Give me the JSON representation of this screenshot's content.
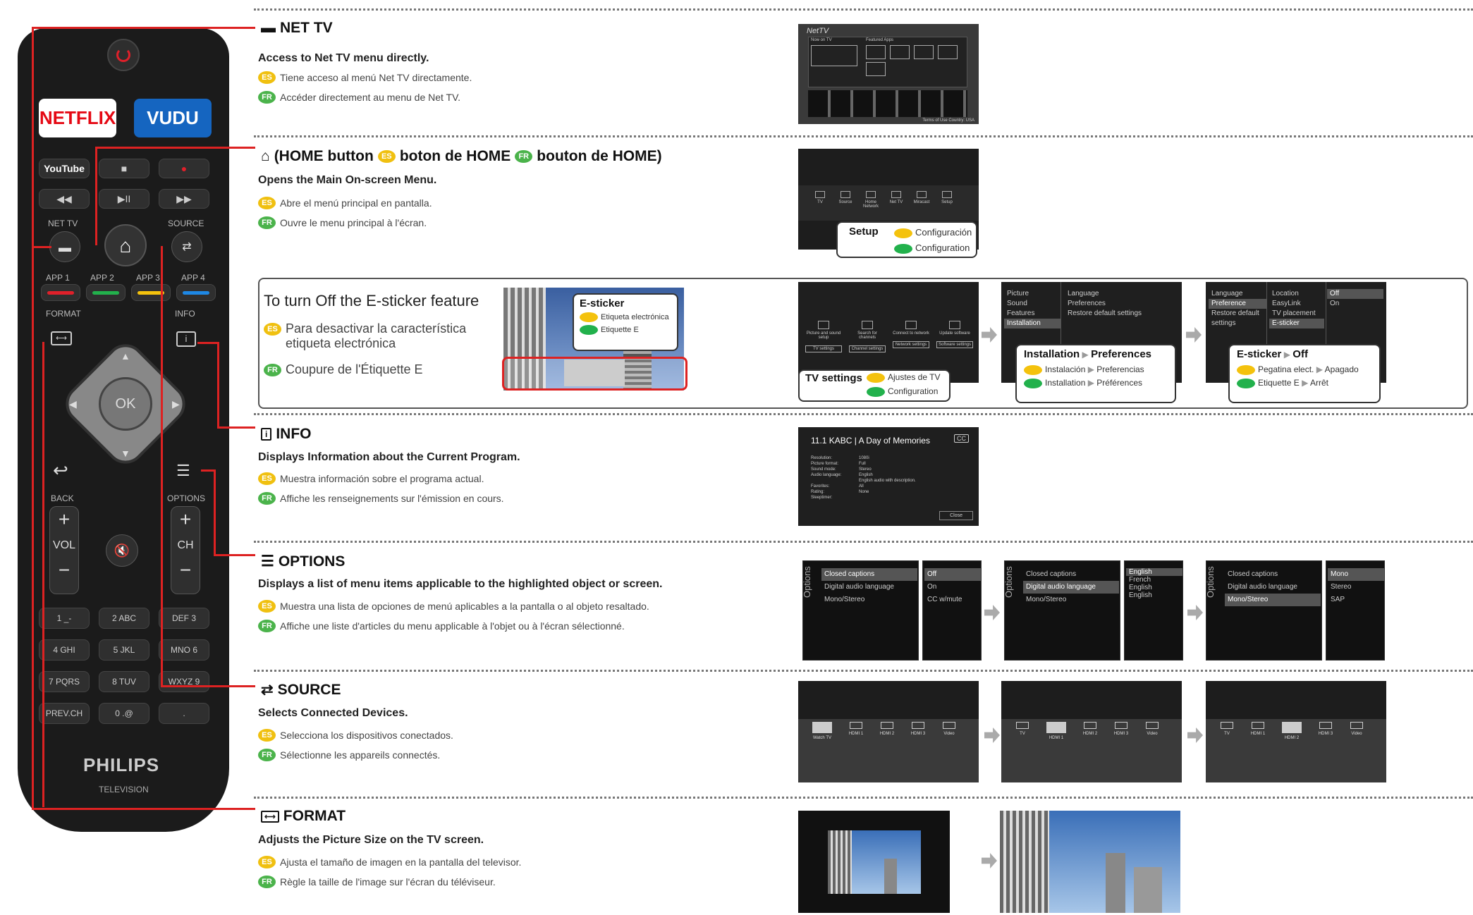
{
  "remote": {
    "brand": "PHILIPS",
    "brand_sub": "TELEVISION",
    "netflix": "NETFLIX",
    "vudu": "VUDU",
    "youtube": "YouTube",
    "labels": {
      "net_tv": "NET TV",
      "source": "SOURCE",
      "app1": "APP 1",
      "app2": "APP 2",
      "app3": "APP 3",
      "app4": "APP 4",
      "format": "FORMAT",
      "info": "INFO",
      "back": "BACK",
      "options": "OPTIONS",
      "vol": "VOL",
      "ch": "CH",
      "ok": "OK"
    },
    "keys": [
      "1 _-",
      "2 ABC",
      "DEF 3",
      "4 GHI",
      "5 JKL",
      "MNO 6",
      "7 PQRS",
      "8 TUV",
      "WXYZ 9",
      "PREV.CH",
      "0 .@",
      "."
    ],
    "colors": {
      "red": "#e0202a",
      "green": "#22b14c",
      "yellow": "#f4c20d",
      "blue": "#1e88e5"
    }
  },
  "sections": {
    "nettv": {
      "title": "NET TV",
      "subtitle": "Access to Net TV menu directly.",
      "es": "Tiene acceso al menú Net TV directamente.",
      "fr": "Accéder directement au menu de Net TV."
    },
    "home": {
      "title": "(HOME button",
      "title_es": "boton de HOME",
      "title_fr": "bouton de HOME)",
      "subtitle": "Opens the Main On-screen Menu.",
      "es": "Abre el menú principal en pantalla.",
      "fr": "Ouvre le menu principal à l'écran.",
      "callout_title": "Setup",
      "callout_es": "Configuración",
      "callout_fr": "Configuration"
    },
    "esticker": {
      "title": "To turn Off the E-sticker feature",
      "es": "Para desactivar la característica etiqueta electrónica",
      "fr": "Coupure de l'Étiquette E",
      "callout_title": "E-sticker",
      "callout_es": "Etiqueta electrónica",
      "callout_fr": "Etiquette E",
      "step1_title": "TV settings",
      "step1_es": "Ajustes de TV",
      "step1_fr": "Configuration",
      "step2_title": "Installation",
      "step2_title2": "Preferences",
      "step2_es": "Instalación",
      "step2_es2": "Preferencias",
      "step2_fr": "Installation",
      "step2_fr2": "Préférences",
      "step3_title": "E-sticker",
      "step3_title2": "Off",
      "step3_es": "Pegatina elect.",
      "step3_es2": "Apagado",
      "step3_fr": "Etiquette E",
      "step3_fr2": "Arrêt"
    },
    "info": {
      "title": "INFO",
      "subtitle": "Displays Information about the Current Program.",
      "es": "Muestra información sobre el programa actual.",
      "fr": "Affiche les renseignements sur l'émission en cours.",
      "screen_header": "11.1 KABC | A Day of Memories",
      "cc": "CC",
      "rows": [
        [
          "Resolution:",
          "1080i"
        ],
        [
          "Picture format:",
          "Full"
        ],
        [
          "Sound mode:",
          "Stereo"
        ],
        [
          "Audio language:",
          "English"
        ],
        [
          "",
          "English audio with description."
        ],
        [
          "Favorites:",
          "All"
        ],
        [
          "Rating:",
          "None"
        ],
        [
          "Sleeptimer:",
          ""
        ]
      ],
      "close": "Close"
    },
    "options": {
      "title": "OPTIONS",
      "subtitle": "Displays a list of menu items applicable to the highlighted object or screen.",
      "es": "Muestra una lista de opciones de menú aplicables a la pantalla o al objeto resaltado.",
      "fr": "Affiche une liste d'articles du menu applicable à l'objet ou à l'écran sélectionné.",
      "panel_label": "Options",
      "items": [
        "Closed captions",
        "Digital audio language",
        "Mono/Stereo"
      ],
      "values1": [
        "Off",
        "On",
        "CC w/mute"
      ],
      "values2": [
        "English",
        "French",
        "English",
        "English"
      ],
      "values3": [
        "Mono",
        "Stereo",
        "SAP"
      ]
    },
    "source": {
      "title": "SOURCE",
      "subtitle": "Selects Connected Devices.",
      "es": "Selecciona los dispositivos conectados.",
      "fr": "Sélectionne les appareils connectés.",
      "inputs1": [
        "Watch TV",
        "HDMI 1",
        "HDMI 2",
        "HDMI 3",
        "Video"
      ],
      "inputs2": [
        "TV",
        "HDMI 1",
        "HDMI 2",
        "HDMI 3",
        "Video"
      ]
    },
    "format": {
      "title": "FORMAT",
      "subtitle": "Adjusts the Picture Size on the TV screen.",
      "es": "Ajusta el tamaño de imagen en la pantalla del televisor.",
      "fr": "Règle la taille de l'image sur l'écran du téléviseur."
    }
  },
  "screens": {
    "nettv_logo": "NetTV",
    "now_on_tv": "Now on TV",
    "featured_apps": "Featured Apps",
    "terms": "Terms of Use   Country: USA",
    "home_items": [
      "TV",
      "Source",
      "Home Network",
      "Net TV",
      "Miracast",
      "Setup"
    ],
    "setup_items": [
      "Picture and sound setup",
      "Search for channels",
      "Connect to network",
      "Update software"
    ],
    "setup_buttons": [
      "TV settings",
      "Channel settings",
      "Network settings",
      "Software settings"
    ],
    "menu2_left": [
      "Picture",
      "Sound",
      "Features",
      "Installation"
    ],
    "menu2_right": [
      "Language",
      "Preferences",
      "Restore default settings"
    ],
    "menu3_left": [
      "Language",
      "Preference",
      "Restore default settings"
    ],
    "menu3_mid": [
      "Location",
      "EasyLink",
      "TV placement",
      "E-sticker"
    ],
    "menu3_right": [
      "Off",
      "On"
    ]
  },
  "badges": {
    "es": "ES",
    "fr": "FR"
  }
}
